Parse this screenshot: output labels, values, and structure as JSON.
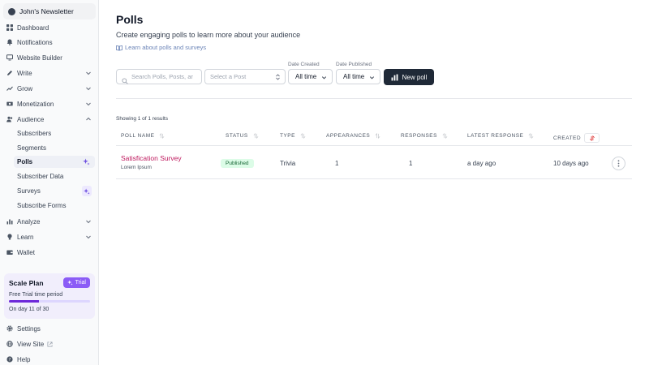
{
  "sidebar": {
    "brand": "John's Newsletter",
    "items": [
      {
        "label": "Dashboard",
        "icon": "grid-icon"
      },
      {
        "label": "Notifications",
        "icon": "bell-icon"
      },
      {
        "label": "Website Builder",
        "icon": "monitor-icon"
      },
      {
        "label": "Write",
        "icon": "pencil-icon"
      },
      {
        "label": "Grow",
        "icon": "trend-up-icon"
      },
      {
        "label": "Monetization",
        "icon": "banknote-icon"
      },
      {
        "label": "Audience",
        "icon": "users-icon"
      }
    ],
    "audience_sub": [
      {
        "label": "Subscribers"
      },
      {
        "label": "Segments"
      },
      {
        "label": "Polls"
      },
      {
        "label": "Subscriber Data"
      },
      {
        "label": "Surveys"
      },
      {
        "label": "Subscribe Forms"
      }
    ],
    "items_bottom": [
      {
        "label": "Analyze",
        "icon": "bar-chart-icon"
      },
      {
        "label": "Learn",
        "icon": "lightbulb-icon"
      },
      {
        "label": "Wallet",
        "icon": "wallet-icon"
      }
    ],
    "plan": {
      "title": "Scale Plan",
      "badge": "Trial",
      "subtitle": "Free Trial time period",
      "progress": 0.37,
      "day_text": "On day 11 of 30"
    },
    "footer": [
      {
        "label": "Settings",
        "icon": "gear-icon"
      },
      {
        "label": "View Site",
        "icon": "globe-icon"
      },
      {
        "label": "Help",
        "icon": "help-icon"
      }
    ]
  },
  "main": {
    "title": "Polls",
    "subtitle": "Create engaging polls to learn more about your audience",
    "learn_link": "Learn about polls and surveys",
    "filters": {
      "search_placeholder": "Search Polls, Posts, ar",
      "post_placeholder": "Select a Post",
      "date_created_label": "Date Created",
      "date_created_value": "All time",
      "date_published_label": "Date Published",
      "date_published_value": "All time",
      "new_poll": "New poll"
    },
    "showing": "Showing 1 of 1 results",
    "columns": [
      "POLL NAME",
      "STATUS",
      "TYPE",
      "APPEARANCES",
      "RESPONSES",
      "LATEST RESPONSE",
      "CREATED"
    ],
    "rows": [
      {
        "name": "Satisfication Survey",
        "description": "Lorem Ipsum",
        "status": "Published",
        "type": "Trivia",
        "appearances": "1",
        "responses": "1",
        "latest_response": "a day ago",
        "created": "10 days ago"
      }
    ]
  },
  "colors": {
    "accent": "#6d28d9",
    "link": "#be185d",
    "primary_button": "#1f2937",
    "published_bg": "#dcfce7"
  }
}
